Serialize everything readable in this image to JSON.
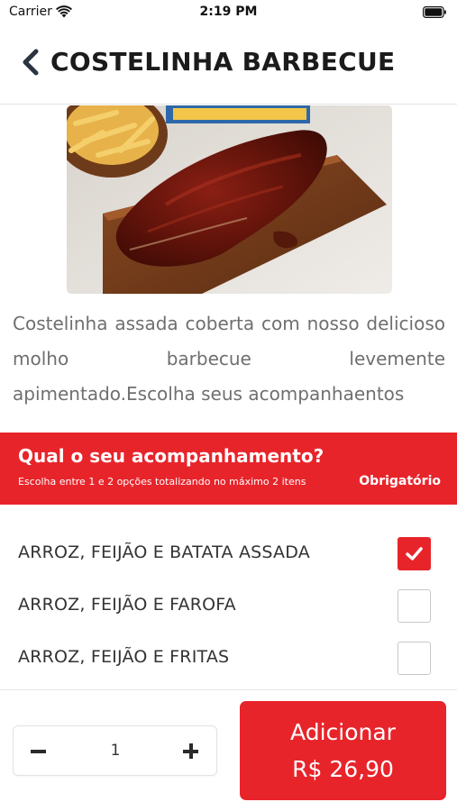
{
  "status_bar": {
    "carrier": "Carrier",
    "time": "2:19 PM"
  },
  "header": {
    "title": "COSTELINHA BARBECUE",
    "back_icon": "chevron-left-icon"
  },
  "product": {
    "image_icon": "food-photo",
    "description": "Costelinha assada coberta com nosso delicioso molho barbecue levemente apimentado.Escolha seus acompanhaentos"
  },
  "section": {
    "title": "Qual o seu acompanhamento?",
    "subtitle": "Escolha entre 1 e 2 opções totalizando no máximo 2 itens",
    "required_label": "Obrigatório"
  },
  "options": [
    {
      "label": "ARROZ, FEIJÃO E BATATA ASSADA",
      "checked": true
    },
    {
      "label": "ARROZ, FEIJÃO E FAROFA",
      "checked": false
    },
    {
      "label": "ARROZ, FEIJÃO E FRITAS",
      "checked": false
    }
  ],
  "footer": {
    "quantity": "1",
    "add_label": "Adicionar",
    "price": "R$ 26,90"
  },
  "colors": {
    "accent": "#e8242b",
    "text_dark": "#1b1b1b",
    "text_muted": "#6f6f6f"
  }
}
